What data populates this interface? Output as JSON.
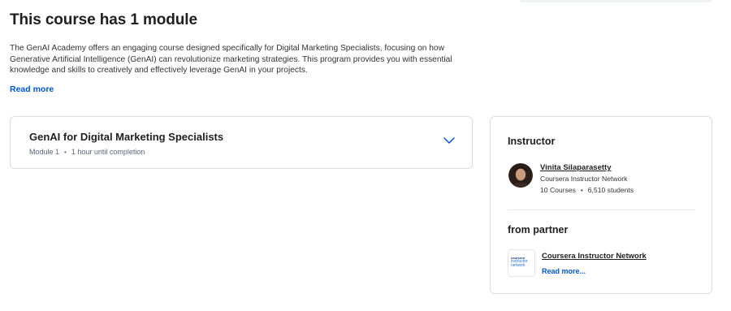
{
  "main": {
    "title": "This course has 1 module",
    "description": "The GenAI Academy offers an engaging course designed specifically for Digital Marketing Specialists, focusing on how Generative Artificial Intelligence (GenAI) can revolutionize marketing strategies. This program provides you with essential knowledge and skills to creatively and effectively leverage GenAI in your projects.",
    "read_more_label": "Read more"
  },
  "module": {
    "title": "GenAI for Digital Marketing Specialists",
    "number_label": "Module 1",
    "separator": "•",
    "duration": "1 hour until completion",
    "expand_icon": "chevron-down-icon"
  },
  "sidebar": {
    "instructor_heading": "Instructor",
    "instructor": {
      "name": "Vinita Silaparasetty",
      "organization": "Coursera Instructor Network",
      "courses": "10 Courses",
      "separator": "•",
      "students": "6,510 students"
    },
    "partner_heading": "from partner",
    "partner": {
      "logo_line1": "coursera",
      "logo_line2": "instructor",
      "logo_line3": "network",
      "name": "Coursera Instructor Network",
      "read_more_label": "Read more..."
    }
  },
  "colors": {
    "link": "#0056d2",
    "border": "#dadce0",
    "text": "#1f1f1f"
  }
}
